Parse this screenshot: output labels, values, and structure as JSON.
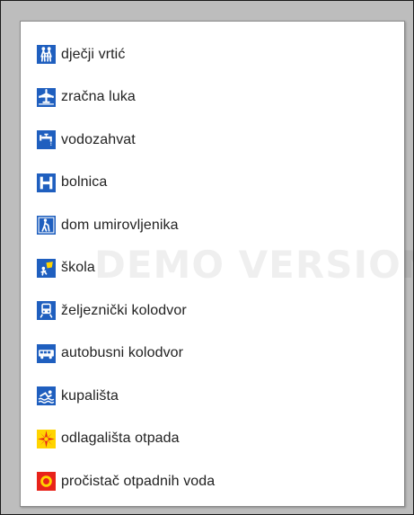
{
  "legend": {
    "items": [
      {
        "label": "dječji vrtić",
        "icon": "kindergarten-icon"
      },
      {
        "label": "zračna luka",
        "icon": "airport-icon"
      },
      {
        "label": "vodozahvat",
        "icon": "water-intake-icon"
      },
      {
        "label": "bolnica",
        "icon": "hospital-icon"
      },
      {
        "label": "dom umirovljenika",
        "icon": "retirement-home-icon"
      },
      {
        "label": "škola",
        "icon": "school-icon"
      },
      {
        "label": "željeznički kolodvor",
        "icon": "railway-station-icon"
      },
      {
        "label": "autobusni kolodvor",
        "icon": "bus-station-icon"
      },
      {
        "label": "kupališta",
        "icon": "swimming-icon"
      },
      {
        "label": "odlagališta otpada",
        "icon": "waste-disposal-icon"
      },
      {
        "label": "pročistač otpadnih voda",
        "icon": "wastewater-treatment-icon"
      }
    ]
  },
  "watermark": {
    "text": "DEMO VERSION"
  },
  "colors": {
    "icon_blue": "#1f5fbf",
    "icon_yellow": "#ffd400",
    "icon_red": "#e8231a"
  }
}
